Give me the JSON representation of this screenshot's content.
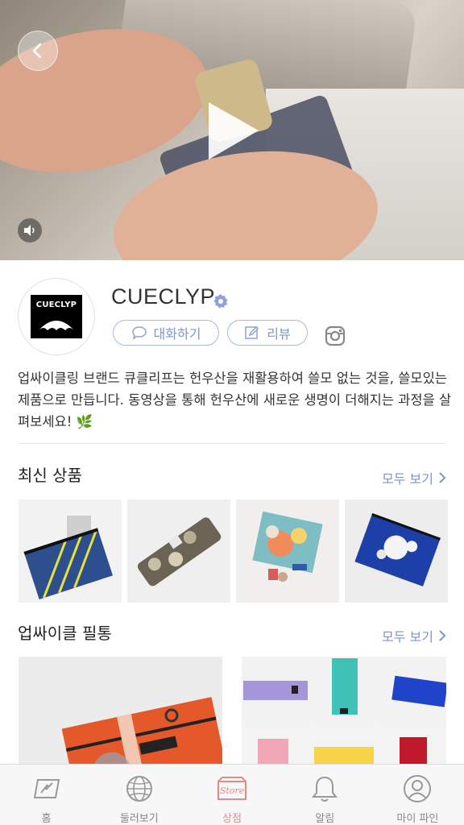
{
  "hero": {
    "back_icon": "chevron-left-icon",
    "play_icon": "play-icon",
    "sound_icon": "speaker-icon"
  },
  "brand": {
    "logo_text": "CUECLYP",
    "name": "CUECLYP",
    "verified_icon": "verified-badge-icon",
    "chat_label": "대화하기",
    "review_label": "리뷰",
    "instagram_icon": "instagram-icon",
    "description": "업싸이클링 브랜드 큐클리프는 헌우산을 재활용하여 쓸모 없는 것을, 쓸모있는 제품으로 만듭니다. 동영상을 통해 헌우산에 새로운 생명이 더해지는 과정을 살펴보세요! 🌿"
  },
  "sections": [
    {
      "title": "최신 상품",
      "see_all": "모두 보기"
    },
    {
      "title": "업싸이클 필통",
      "see_all": "모두 보기"
    }
  ],
  "tabbar": {
    "items": [
      {
        "label": "홈",
        "icon": "home-icon",
        "active": false
      },
      {
        "label": "둘러보기",
        "icon": "globe-icon",
        "active": false
      },
      {
        "label": "상점",
        "icon": "store-icon",
        "active": true
      },
      {
        "label": "알림",
        "icon": "bell-icon",
        "active": false
      },
      {
        "label": "마이 파인",
        "icon": "profile-icon",
        "active": false
      }
    ]
  },
  "colors": {
    "accent": "#7f93cc",
    "active_tab": "#e08a8a"
  }
}
